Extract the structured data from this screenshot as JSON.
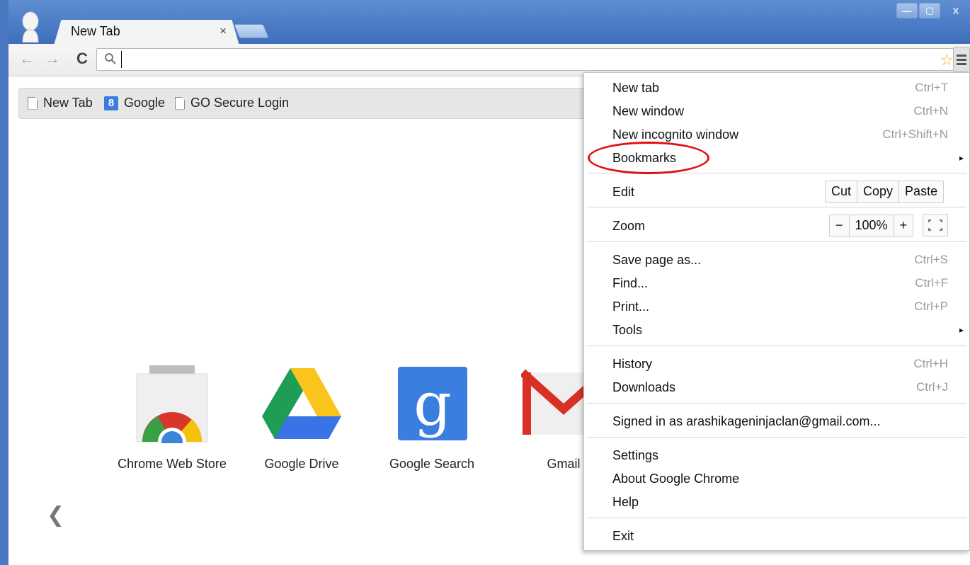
{
  "tab": {
    "title": "New Tab",
    "close": "×"
  },
  "window_controls": {
    "minimize": "—",
    "maximize": "▢",
    "close": "X"
  },
  "toolbar": {
    "back": "←",
    "forward": "→",
    "reload": "C",
    "omnibox_value": ""
  },
  "bookmarks": [
    {
      "label": "New Tab",
      "icon": "page-icon"
    },
    {
      "label": "Google",
      "icon": "google-icon",
      "glyph": "8"
    },
    {
      "label": "GO Secure Login",
      "icon": "page-icon"
    }
  ],
  "apps": [
    {
      "label": "Chrome Web Store",
      "icon": "chrome-web-store-icon"
    },
    {
      "label": "Google Drive",
      "icon": "google-drive-icon"
    },
    {
      "label": "Google Search",
      "icon": "google-search-icon"
    },
    {
      "label": "Gmail",
      "icon": "gmail-icon"
    }
  ],
  "prev_arrow": "❮",
  "menu": {
    "new_tab": {
      "label": "New tab",
      "shortcut": "Ctrl+T"
    },
    "new_window": {
      "label": "New window",
      "shortcut": "Ctrl+N"
    },
    "new_incognito": {
      "label": "New incognito window",
      "shortcut": "Ctrl+Shift+N"
    },
    "bookmarks": {
      "label": "Bookmarks",
      "arrow": "▸"
    },
    "edit": {
      "label": "Edit",
      "cut": "Cut",
      "copy": "Copy",
      "paste": "Paste"
    },
    "zoom": {
      "label": "Zoom",
      "minus": "−",
      "value": "100%",
      "plus": "+"
    },
    "save_page": {
      "label": "Save page as...",
      "shortcut": "Ctrl+S"
    },
    "find": {
      "label": "Find...",
      "shortcut": "Ctrl+F"
    },
    "print": {
      "label": "Print...",
      "shortcut": "Ctrl+P"
    },
    "tools": {
      "label": "Tools",
      "arrow": "▸"
    },
    "history": {
      "label": "History",
      "shortcut": "Ctrl+H"
    },
    "downloads": {
      "label": "Downloads",
      "shortcut": "Ctrl+J"
    },
    "signed_in": {
      "label": "Signed in as arashikageninjaclan@gmail.com..."
    },
    "settings": {
      "label": "Settings"
    },
    "about": {
      "label": "About Google Chrome"
    },
    "help": {
      "label": "Help"
    },
    "exit": {
      "label": "Exit"
    }
  },
  "colors": {
    "frame": "#4f7fc8",
    "highlight": "#e01010",
    "star": "#f2b21b"
  }
}
